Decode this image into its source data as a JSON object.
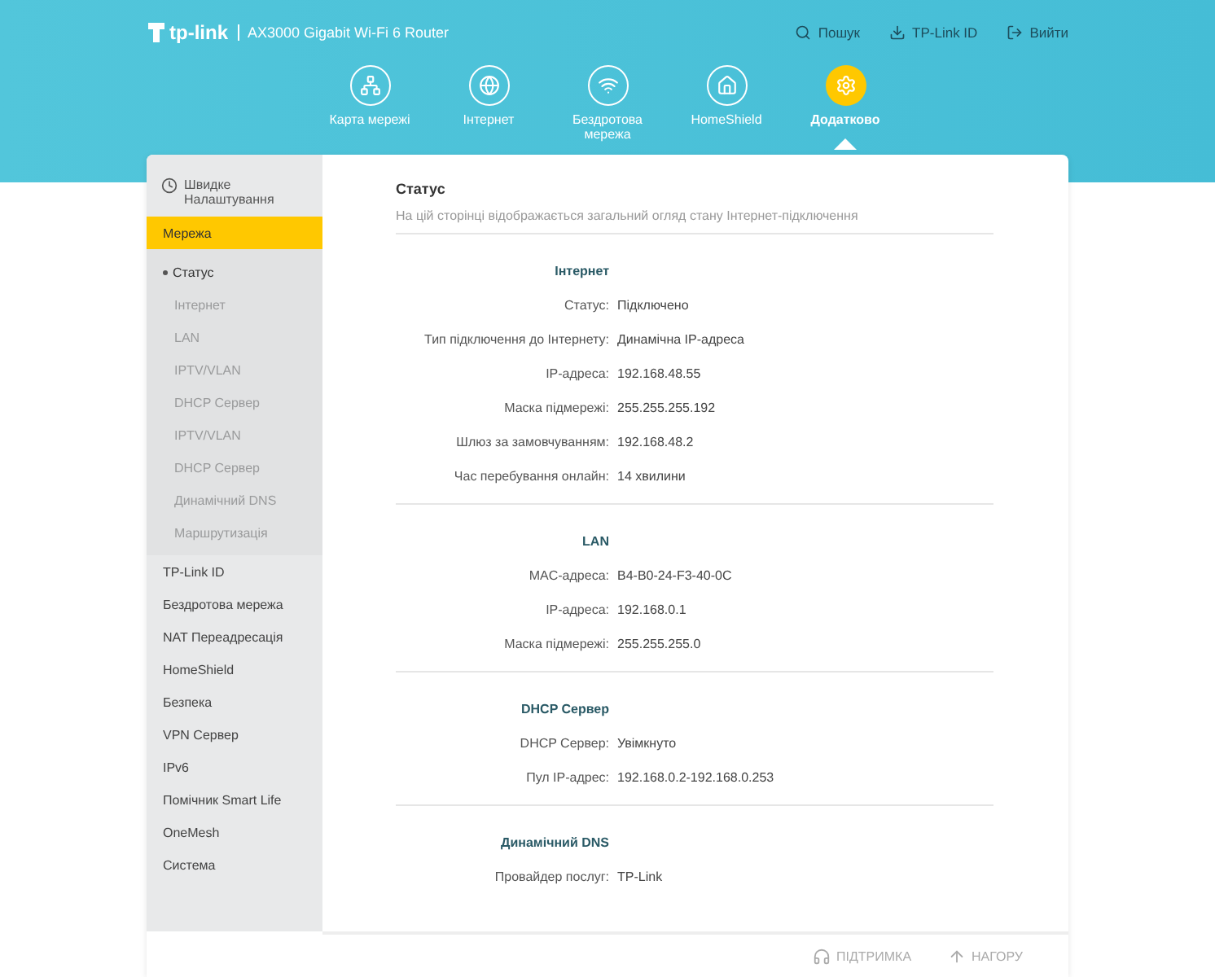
{
  "header": {
    "brand": "tp-link",
    "model": "AX3000 Gigabit Wi-Fi 6 Router",
    "links": [
      {
        "label": "Пошук"
      },
      {
        "label": "TP-Link ID"
      },
      {
        "label": "Вийти"
      }
    ]
  },
  "nav": [
    {
      "label": "Карта мережі",
      "selected": false
    },
    {
      "label": "Інтернет",
      "selected": false
    },
    {
      "label": "Бездротова мережа",
      "selected": false
    },
    {
      "label": "HomeShield",
      "selected": false
    },
    {
      "label": "Додатково",
      "selected": true
    }
  ],
  "sidebar": {
    "quick_setup": "Швидке Налаштування",
    "items": [
      {
        "label": "Мережа",
        "selected": true,
        "children": [
          {
            "label": "Статус",
            "selected": true
          },
          {
            "label": "Інтернет",
            "selected": false
          },
          {
            "label": "LAN",
            "selected": false
          },
          {
            "label": "IPTV/VLAN",
            "selected": false
          },
          {
            "label": "DHCP Сервер",
            "selected": false
          },
          {
            "label": "IPTV/VLAN",
            "selected": false
          },
          {
            "label": "DHCP Сервер",
            "selected": false
          },
          {
            "label": "Динамічний DNS",
            "selected": false
          },
          {
            "label": "Маршрутизація",
            "selected": false
          }
        ]
      },
      {
        "label": "TP-Link ID",
        "selected": false
      },
      {
        "label": "Бездротова мережа",
        "selected": false
      },
      {
        "label": "NAT Переадресація",
        "selected": false
      },
      {
        "label": "HomeShield",
        "selected": false
      },
      {
        "label": "Безпека",
        "selected": false
      },
      {
        "label": "VPN Сервер",
        "selected": false
      },
      {
        "label": "IPv6",
        "selected": false
      },
      {
        "label": "Помічник Smart Life",
        "selected": false
      },
      {
        "label": "OneMesh",
        "selected": false
      },
      {
        "label": "Система",
        "selected": false
      }
    ]
  },
  "page": {
    "title": "Статус",
    "description": "На цій сторінці відображається загальний огляд стану Інтернет-підключення",
    "sections": [
      {
        "title": "Інтернет",
        "rows": [
          {
            "label": "Статус:",
            "value": "Підключено"
          },
          {
            "label": "Тип підключення до Інтернету:",
            "value": "Динамічна IP-адреса"
          },
          {
            "label": "IP-адреса:",
            "value": "192.168.48.55"
          },
          {
            "label": "Маска підмережі:",
            "value": "255.255.255.192"
          },
          {
            "label": "Шлюз за замовчуванням:",
            "value": "192.168.48.2"
          },
          {
            "label": "Час перебування онлайн:",
            "value": "14 хвилини"
          }
        ]
      },
      {
        "title": "LAN",
        "rows": [
          {
            "label": "MAC-адреса:",
            "value": "B4-B0-24-F3-40-0C"
          },
          {
            "label": "IP-адреса:",
            "value": "192.168.0.1"
          },
          {
            "label": "Маска підмережі:",
            "value": "255.255.255.0"
          }
        ]
      },
      {
        "title": "DHCP Сервер",
        "rows": [
          {
            "label": "DHCP Сервер:",
            "value": "Увімкнуто"
          },
          {
            "label": "Пул IP-адрес:",
            "value": "192.168.0.2-192.168.0.253"
          }
        ]
      },
      {
        "title": "Динамічний DNS",
        "rows": [
          {
            "label": "Провайдер послуг:",
            "value": "TP-Link"
          }
        ]
      }
    ]
  },
  "footer": {
    "links": [
      {
        "label": "ПІДТРИМКА"
      },
      {
        "label": "НАГОРУ"
      }
    ]
  }
}
